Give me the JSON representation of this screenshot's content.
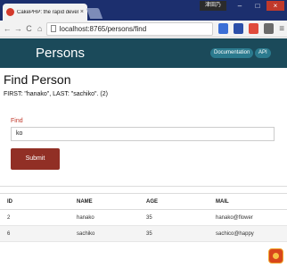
{
  "browser": {
    "tab_title": "CakePHP: the rapid devel",
    "tab_close": "×",
    "user_badge": "津田乃",
    "url": "localhost:8765/persons/find",
    "nav_back": "←",
    "nav_forward": "→",
    "nav_reload": "C",
    "nav_home": "⌂",
    "menu": "≡",
    "win_minimize": "–",
    "win_maximize": "□",
    "win_close": "×"
  },
  "header": {
    "title": "Persons",
    "documentation_link": "Documentation",
    "api_link": "API"
  },
  "main": {
    "heading": "Find Person",
    "summary": "FIRST: \"hanako\", LAST: \"sachiko\". (2)",
    "find_label": "Find",
    "find_value": "ko",
    "submit_label": "Submit"
  },
  "table": {
    "headers": [
      "ID",
      "NAME",
      "AGE",
      "MAIL"
    ],
    "rows": [
      [
        "2",
        "hanako",
        "35",
        "hanako@flower"
      ],
      [
        "6",
        "sachiko",
        "35",
        "sachico@happy"
      ]
    ]
  },
  "colors": {
    "app_header": "#1b4a5a",
    "submit": "#912f25",
    "label": "#c0392b"
  }
}
